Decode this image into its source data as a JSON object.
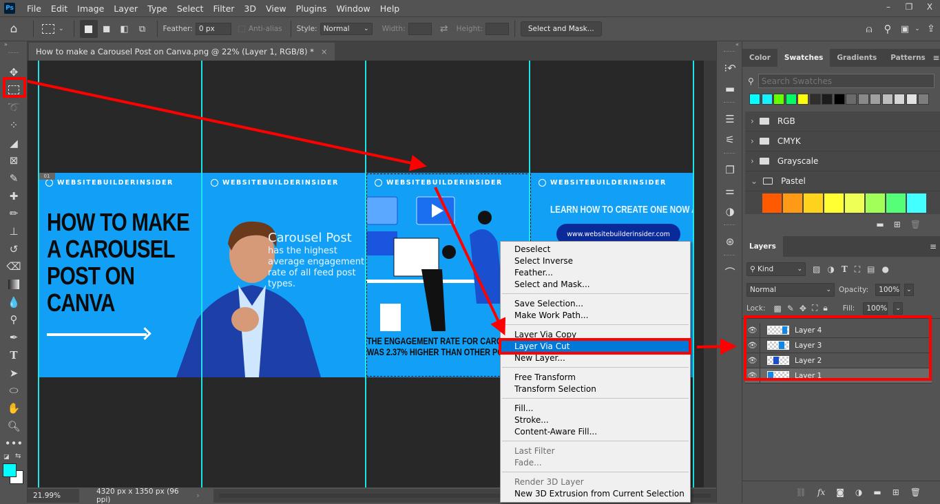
{
  "app": {
    "logo": "Ps"
  },
  "menubar": {
    "items": [
      "File",
      "Edit",
      "Image",
      "Layer",
      "Type",
      "Select",
      "Filter",
      "3D",
      "View",
      "Plugins",
      "Window",
      "Help"
    ]
  },
  "window_controls": {
    "minimize": "–",
    "restore": "❐",
    "close": "X"
  },
  "options_bar": {
    "feather_label": "Feather:",
    "feather_value": "0 px",
    "anti_alias_label": "Anti-alias",
    "style_label": "Style:",
    "style_value": "Normal",
    "width_label": "Width:",
    "height_label": "Height:",
    "select_mask_button": "Select and Mask..."
  },
  "document": {
    "tab_title": "How to make a Carousel Post on Canva.png @ 22% (Layer 1, RGB/8) *",
    "close_icon": "×",
    "zoom_level": "21.99%",
    "doc_info": "4320 px x 1350 px (96 ppi)",
    "artboard_label": "01"
  },
  "canvas_content": {
    "brand": "WEBSITEBUILDERINSIDER",
    "slide1_headline": [
      "HOW TO MAKE",
      "A CAROUSEL",
      "POST ON",
      "CANVA"
    ],
    "slide2_title": "Carousel Post",
    "slide2_body": "has the highest average engagement rate of all feed post types.",
    "slide3_stat": [
      "THE ENGAGEMENT RATE FOR CAROUSEL",
      "WAS 2.37% HIGHER THAN OTHER POST"
    ],
    "slide4_cta": "LEARN HOW TO CREATE ONE NOW AT",
    "slide4_url": "www.websitebuilderinsider.com",
    "bg_color": "#12a0f6"
  },
  "context_menu": {
    "groups": [
      [
        {
          "label": "Deselect"
        },
        {
          "label": "Select Inverse"
        },
        {
          "label": "Feather..."
        },
        {
          "label": "Select and Mask..."
        }
      ],
      [
        {
          "label": "Save Selection..."
        },
        {
          "label": "Make Work Path..."
        }
      ],
      [
        {
          "label": "Layer Via Copy"
        },
        {
          "label": "Layer Via Cut",
          "highlighted": true
        },
        {
          "label": "New Layer..."
        }
      ],
      [
        {
          "label": "Free Transform"
        },
        {
          "label": "Transform Selection"
        }
      ],
      [
        {
          "label": "Fill..."
        },
        {
          "label": "Stroke..."
        },
        {
          "label": "Content-Aware Fill..."
        }
      ],
      [
        {
          "label": "Last Filter",
          "disabled": true
        },
        {
          "label": "Fade...",
          "disabled": true
        }
      ],
      [
        {
          "label": "Render 3D Layer",
          "disabled": true
        },
        {
          "label": "New 3D Extrusion from Current Selection"
        }
      ]
    ]
  },
  "swatches_panel": {
    "tabs": [
      "Color",
      "Swatches",
      "Gradients",
      "Patterns"
    ],
    "active_tab": "Swatches",
    "search_placeholder": "Search Swatches",
    "recent_colors": [
      "#00ffff",
      "#17f0ff",
      "#66ff00",
      "#00ff66",
      "#ffff00",
      "#2e2e2e",
      "#1c1c1c",
      "#000000",
      "#6b6b6b",
      "#898989",
      "#a0a0a0",
      "#bdbdbd",
      "#d6d6d6",
      "#e2e2e2",
      "#7d7d7d"
    ],
    "groups": [
      {
        "name": "RGB",
        "expanded": false
      },
      {
        "name": "CMYK",
        "expanded": false
      },
      {
        "name": "Grayscale",
        "expanded": false
      },
      {
        "name": "Pastel",
        "expanded": true
      }
    ],
    "pastel_colors": [
      "#ff5a00",
      "#ff9a16",
      "#ffd21e",
      "#ffff33",
      "#eeff55",
      "#a2ff5a",
      "#55ff77",
      "#44ffff"
    ]
  },
  "layers_panel": {
    "title": "Layers",
    "filter_kind": "Kind",
    "blend_mode": "Normal",
    "opacity_label": "Opacity:",
    "opacity_value": "100%",
    "lock_label": "Lock:",
    "fill_label": "Fill:",
    "fill_value": "100%",
    "layers": [
      {
        "name": "Layer 4",
        "visible": true,
        "selected": false
      },
      {
        "name": "Layer 3",
        "visible": true,
        "selected": false
      },
      {
        "name": "Layer 2",
        "visible": true,
        "selected": false
      },
      {
        "name": "Layer 1",
        "visible": true,
        "selected": true
      }
    ]
  },
  "colors": {
    "foreground": "#00ffff",
    "background": "#ffffff",
    "annotation_red": "#ff0000",
    "menu_highlight": "#0078d7",
    "guide": "#1ee6e6"
  }
}
